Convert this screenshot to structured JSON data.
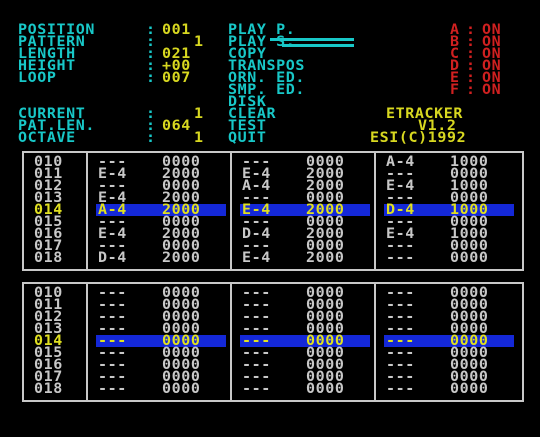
{
  "info": {
    "rows": [
      {
        "label": "POSITION",
        "value": "001"
      },
      {
        "label": "PATTERN",
        "value": "1"
      },
      {
        "label": "LENGTH",
        "value": "021"
      },
      {
        "label": "HEIGHT",
        "value": "+00"
      },
      {
        "label": "LOOP",
        "value": "007"
      }
    ],
    "rows2": [
      {
        "label": "CURRENT",
        "value": "1"
      },
      {
        "label": "PAT.LEN.",
        "value": "064"
      },
      {
        "label": "OCTAVE",
        "value": "1"
      }
    ]
  },
  "menu": [
    "PLAY P.",
    "PLAY S.",
    "COPY",
    "TRANSPOS",
    "ORN. ED.",
    "SMP. ED.",
    "DISK",
    "CLEAR",
    "TEST",
    "QUIT"
  ],
  "channels": [
    {
      "name": "A",
      "state": "ON"
    },
    {
      "name": "B",
      "state": "ON"
    },
    {
      "name": "C",
      "state": "ON"
    },
    {
      "name": "D",
      "state": "ON"
    },
    {
      "name": "E",
      "state": "ON"
    },
    {
      "name": "F",
      "state": "ON"
    }
  ],
  "title": {
    "name": "ETRACKER",
    "version": "V1.2",
    "copyright": "ESI(C)1992"
  },
  "pattern1": {
    "rows": [
      {
        "num": "010",
        "c": [
          [
            "---",
            "0000"
          ],
          [
            "---",
            "0000"
          ],
          [
            "A-4",
            "1000"
          ]
        ]
      },
      {
        "num": "011",
        "c": [
          [
            "E-4",
            "2000"
          ],
          [
            "E-4",
            "2000"
          ],
          [
            "---",
            "0000"
          ]
        ]
      },
      {
        "num": "012",
        "c": [
          [
            "---",
            "0000"
          ],
          [
            "A-4",
            "2000"
          ],
          [
            "E-4",
            "1000"
          ]
        ]
      },
      {
        "num": "013",
        "c": [
          [
            "E-4",
            "2000"
          ],
          [
            "---",
            "0000"
          ],
          [
            "---",
            "0000"
          ]
        ]
      },
      {
        "num": "014",
        "c": [
          [
            "A-4",
            "2000"
          ],
          [
            "E-4",
            "2000"
          ],
          [
            "D-4",
            "1000"
          ]
        ]
      },
      {
        "num": "015",
        "c": [
          [
            "---",
            "0000"
          ],
          [
            "---",
            "0000"
          ],
          [
            "---",
            "0000"
          ]
        ]
      },
      {
        "num": "016",
        "c": [
          [
            "E-4",
            "2000"
          ],
          [
            "D-4",
            "2000"
          ],
          [
            "E-4",
            "1000"
          ]
        ]
      },
      {
        "num": "017",
        "c": [
          [
            "---",
            "0000"
          ],
          [
            "---",
            "0000"
          ],
          [
            "---",
            "0000"
          ]
        ]
      },
      {
        "num": "018",
        "c": [
          [
            "D-4",
            "2000"
          ],
          [
            "E-4",
            "2000"
          ],
          [
            "---",
            "0000"
          ]
        ]
      }
    ]
  },
  "pattern2": {
    "rows": [
      {
        "num": "010",
        "c": [
          [
            "---",
            "0000"
          ],
          [
            "---",
            "0000"
          ],
          [
            "---",
            "0000"
          ]
        ]
      },
      {
        "num": "011",
        "c": [
          [
            "---",
            "0000"
          ],
          [
            "---",
            "0000"
          ],
          [
            "---",
            "0000"
          ]
        ]
      },
      {
        "num": "012",
        "c": [
          [
            "---",
            "0000"
          ],
          [
            "---",
            "0000"
          ],
          [
            "---",
            "0000"
          ]
        ]
      },
      {
        "num": "013",
        "c": [
          [
            "---",
            "0000"
          ],
          [
            "---",
            "0000"
          ],
          [
            "---",
            "0000"
          ]
        ]
      },
      {
        "num": "014",
        "c": [
          [
            "---",
            "0000"
          ],
          [
            "---",
            "0000"
          ],
          [
            "---",
            "0000"
          ]
        ]
      },
      {
        "num": "015",
        "c": [
          [
            "---",
            "0000"
          ],
          [
            "---",
            "0000"
          ],
          [
            "---",
            "0000"
          ]
        ]
      },
      {
        "num": "016",
        "c": [
          [
            "---",
            "0000"
          ],
          [
            "---",
            "0000"
          ],
          [
            "---",
            "0000"
          ]
        ]
      },
      {
        "num": "017",
        "c": [
          [
            "---",
            "0000"
          ],
          [
            "---",
            "0000"
          ],
          [
            "---",
            "0000"
          ]
        ]
      },
      {
        "num": "018",
        "c": [
          [
            "---",
            "0000"
          ],
          [
            "---",
            "0000"
          ],
          [
            "---",
            "0000"
          ]
        ]
      }
    ]
  },
  "colors": {
    "cyan": "#18c8c8",
    "yellow": "#d8d820",
    "red": "#d02020",
    "grey": "#c8c8c8",
    "cursor": "#1428d8"
  }
}
